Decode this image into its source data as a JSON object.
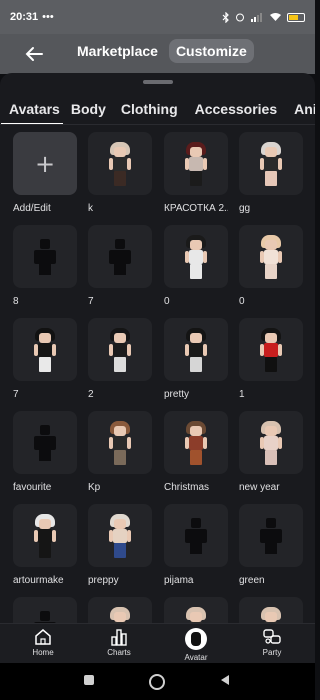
{
  "status": {
    "time": "20:31",
    "dots": "•••",
    "battery_percent": 63,
    "battery_fill_color": "#f5c518"
  },
  "header": {
    "tabs": [
      "Marketplace",
      "Customize"
    ],
    "active_tab": "Customize",
    "back_icon": "arrow-left-icon"
  },
  "category_tabs": [
    "Avatars",
    "Body",
    "Clothing",
    "Accessories",
    "Anim"
  ],
  "active_category": "Avatars",
  "avatars": [
    {
      "label": "Add/Edit",
      "kind": "add"
    },
    {
      "label": "k",
      "kind": "figure",
      "hair": "#d7c6b6",
      "body": "#2b2b2b",
      "legs": "#3b2a24"
    },
    {
      "label": "КРАСОТКА 2...",
      "kind": "figure",
      "hair": "#5a1c1c",
      "body": "#c7b8b0",
      "legs": "#1b1b1b"
    },
    {
      "label": "gg",
      "kind": "figure",
      "hair": "#d9d4d0",
      "body": "#2a2a2a",
      "legs": "#e6c7b8"
    },
    {
      "label": "8",
      "kind": "silhouette"
    },
    {
      "label": "7",
      "kind": "silhouette"
    },
    {
      "label": "0",
      "kind": "figure",
      "hair": "#1a1a1a",
      "body": "#e8e8e8",
      "legs": "#e8e8e8"
    },
    {
      "label": "0",
      "kind": "figure",
      "hair": "#e8c9a8",
      "body": "#f1e1d6",
      "legs": "#e8d4c8"
    },
    {
      "label": "7",
      "kind": "figure",
      "hair": "#121212",
      "body": "#161616",
      "legs": "#e9e9e9"
    },
    {
      "label": "2",
      "kind": "figure",
      "hair": "#151515",
      "body": "#1c1c1c",
      "legs": "#dcdcdc"
    },
    {
      "label": "pretty",
      "kind": "figure",
      "hair": "#141414",
      "body": "#1a1a1a",
      "legs": "#d6d6d6"
    },
    {
      "label": "1",
      "kind": "figure",
      "hair": "#141414",
      "body": "#c81e1e",
      "legs": "#101010"
    },
    {
      "label": "favourite",
      "kind": "silhouette"
    },
    {
      "label": "Kp",
      "kind": "figure",
      "hair": "#8a5a3c",
      "body": "#2a2a2a",
      "legs": "#7a6a5a"
    },
    {
      "label": "Christmas",
      "kind": "figure",
      "hair": "#6b4a34",
      "body": "#8c3d2a",
      "legs": "#a0522d"
    },
    {
      "label": "new year",
      "kind": "figure",
      "hair": "#d8c2b0",
      "body": "#e8d2c8",
      "legs": "#d9c0b8"
    },
    {
      "label": "artourmake",
      "kind": "figure",
      "hair": "#e6e6e6",
      "body": "#151515",
      "legs": "#151515"
    },
    {
      "label": "preppy",
      "kind": "figure",
      "hair": "#e0d8cf",
      "body": "#e5d2c2",
      "legs": "#2f4a8c"
    },
    {
      "label": "pijama",
      "kind": "silhouette"
    },
    {
      "label": "green",
      "kind": "silhouette"
    },
    {
      "label": "",
      "kind": "silhouette"
    },
    {
      "label": "",
      "kind": "figure",
      "hair": "#d8c2b0",
      "body": "#2a2a2a",
      "legs": "#2a2a2a"
    },
    {
      "label": "",
      "kind": "figure",
      "hair": "#d8c2b0",
      "body": "#2a2a2a",
      "legs": "#2a2a2a"
    },
    {
      "label": "",
      "kind": "figure",
      "hair": "#d8c2b0",
      "body": "#2a2a2a",
      "legs": "#2a2a2a"
    }
  ],
  "bottom_nav": [
    {
      "label": "Home",
      "icon": "home-icon"
    },
    {
      "label": "Charts",
      "icon": "bar-chart-icon"
    },
    {
      "label": "Avatar",
      "icon": "avatar-icon"
    },
    {
      "label": "Party",
      "icon": "party-icon"
    }
  ]
}
